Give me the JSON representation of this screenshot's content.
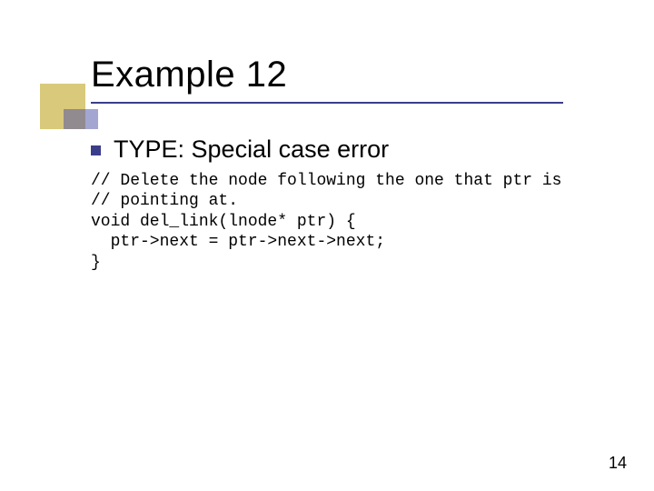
{
  "title": "Example 12",
  "bullet": {
    "label": "TYPE: Special case error"
  },
  "code": {
    "line1": "// Delete the node following the one that ptr is",
    "line2": "// pointing at.",
    "line3": "void del_link(lnode* ptr) {",
    "line4": "  ptr->next = ptr->next->next;",
    "line5": "}"
  },
  "page_number": "14"
}
